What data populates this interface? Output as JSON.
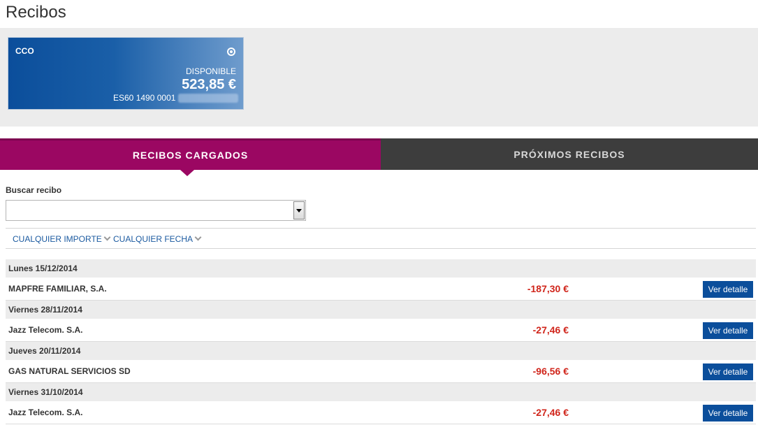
{
  "page": {
    "title": "Recibos"
  },
  "account": {
    "name": "CCO",
    "available_label": "DISPONIBLE",
    "balance": "523,85 €",
    "iban_prefix": "ES60 1490 0001"
  },
  "tabs": [
    {
      "label": "RECIBOS CARGADOS",
      "active": true
    },
    {
      "label": "PRÓXIMOS RECIBOS",
      "active": false
    }
  ],
  "search": {
    "label": "Buscar recibo",
    "value": "",
    "placeholder": ""
  },
  "filters": {
    "amount": "CUALQUIER IMPORTE",
    "date": "CUALQUIER FECHA"
  },
  "receipts": [
    {
      "date": "Lunes 15/12/2014",
      "payee": "MAPFRE FAMILIAR, S.A.",
      "amount": "-187,30 €",
      "button": "Ver detalle"
    },
    {
      "date": "Viernes 28/11/2014",
      "payee": "Jazz Telecom. S.A.",
      "amount": "-27,46 €",
      "button": "Ver detalle"
    },
    {
      "date": "Jueves 20/11/2014",
      "payee": "GAS NATURAL SERVICIOS SD",
      "amount": "-96,56 €",
      "button": "Ver detalle"
    },
    {
      "date": "Viernes 31/10/2014",
      "payee": "Jazz Telecom. S.A.",
      "amount": "-27,46 €",
      "button": "Ver detalle"
    }
  ],
  "colors": {
    "tab_active": "#9b0762",
    "tab_inactive": "#3d3d3d",
    "card_blue": "#0b4e9b",
    "amount_red": "#d0251b",
    "link_blue": "#1b5aa0"
  }
}
